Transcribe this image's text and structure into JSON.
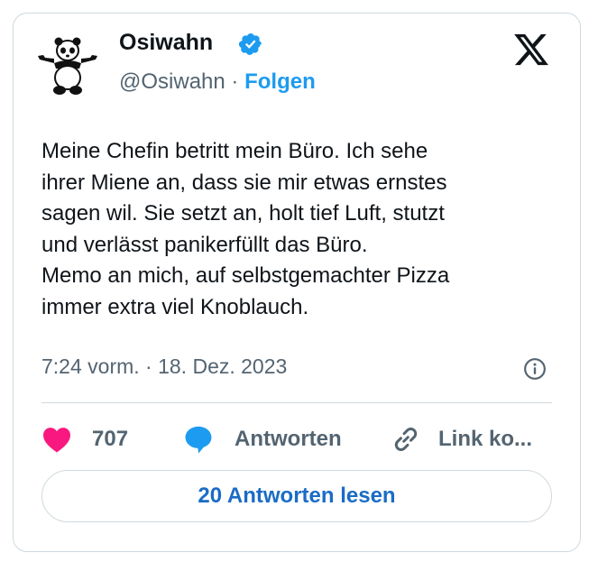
{
  "author": {
    "name": "Osiwahn",
    "handle": "@Osiwahn",
    "separator": "·",
    "follow_label": "Folgen",
    "verified": true
  },
  "post": {
    "text": "Meine Chefin betritt mein Büro. Ich sehe\nihrer Miene an, dass sie mir etwas ernstes\nsagen wil. Sie setzt an, holt tief Luft, stutzt\nund verlässt panikerfüllt das Büro.\nMemo an mich, auf selbstgemachter Pizza\nimmer extra viel Knoblauch.",
    "timestamp": "7:24 vorm. · 18. Dez. 2023"
  },
  "actions": {
    "likes": "707",
    "reply_label": "Antworten",
    "copy_label": "Link ko..."
  },
  "read_replies_label": "20 Antworten lesen",
  "icons": {
    "platform": "x-logo-icon",
    "verified": "verified-badge-icon",
    "info": "info-icon",
    "like": "heart-icon",
    "reply": "speech-bubble-icon",
    "copy": "link-icon"
  },
  "colors": {
    "accent": "#1d9bf0",
    "like": "#f91880",
    "border": "#cfd9de",
    "muted": "#536471",
    "text": "#0f1419",
    "read_button_text": "#1a6cc6"
  }
}
